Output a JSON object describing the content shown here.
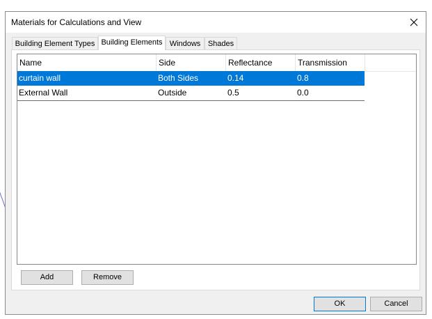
{
  "dialog": {
    "title": "Materials for Calculations and View"
  },
  "tabs": [
    {
      "label": "Building Element Types",
      "active": false
    },
    {
      "label": "Building Elements",
      "active": true
    },
    {
      "label": "Windows",
      "active": false
    },
    {
      "label": "Shades",
      "active": false
    }
  ],
  "table": {
    "columns": [
      "Name",
      "Side",
      "Reflectance",
      "Transmission"
    ],
    "rows": [
      {
        "name": "curtain wall",
        "side": "Both Sides",
        "reflectance": "0.14",
        "transmission": "0.8",
        "selected": true
      },
      {
        "name": "External Wall",
        "side": "Outside",
        "reflectance": "0.5",
        "transmission": "0.0",
        "selected": false
      }
    ]
  },
  "buttons": {
    "add": "Add",
    "remove": "Remove",
    "ok": "OK",
    "cancel": "Cancel"
  },
  "colors": {
    "selection": "#0078d7",
    "dialog_bg": "#f0f0f0"
  }
}
